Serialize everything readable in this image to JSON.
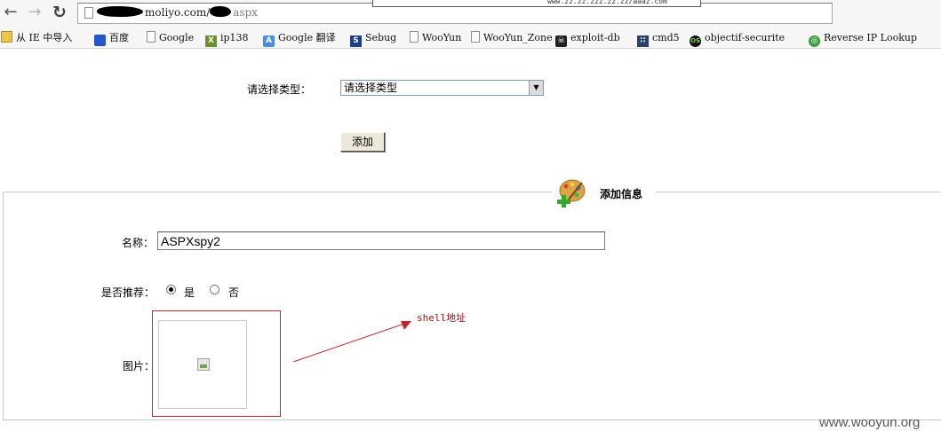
{
  "browser": {
    "nav": {
      "back_glyph": "←",
      "forward_glyph": "→",
      "reload_glyph": "↻"
    },
    "url": {
      "domain": "moliyo.com/",
      "path": "aspx"
    },
    "autocomplete_snippet": "www.zz.zz.zzz.zz.zz/aaaz.com",
    "bookmarks": [
      {
        "label": "从 IE 中导入",
        "icon": "folder-icon"
      },
      {
        "label": "百度",
        "icon": "baidu-icon"
      },
      {
        "label": "Google",
        "icon": "page-icon"
      },
      {
        "label": "ip138",
        "icon": "ip138-icon"
      },
      {
        "label": "Google 翻译",
        "icon": "google-translate-icon"
      },
      {
        "label": "Sebug",
        "icon": "sebug-icon"
      },
      {
        "label": "WooYun",
        "icon": "page-icon"
      },
      {
        "label": "WooYun_Zone",
        "icon": "page-icon"
      },
      {
        "label": "exploit-db",
        "icon": "exploit-db-icon"
      },
      {
        "label": "cmd5",
        "icon": "cmd5-icon"
      },
      {
        "label": "objectif-securite",
        "icon": "objectif-securite-icon"
      },
      {
        "label": "Reverse IP Lookup",
        "icon": "globe-icon"
      }
    ]
  },
  "form": {
    "type_label": "请选择类型：",
    "type_select_value": "请选择类型",
    "add_button": "添加",
    "section_title": "添加信息",
    "name_label": "名称：",
    "name_value": "ASPXspy2",
    "recommend_label": "是否推荐：",
    "recommend_yes": "是",
    "recommend_no": "否",
    "recommend_selected": "yes",
    "image_label": "图片："
  },
  "annotation": {
    "text": "shell地址",
    "color": "#a50f12"
  },
  "watermark": "www.wooyun.org",
  "colors": {
    "annotation_red": "#c0282b",
    "fieldset_border": "#c8c8c8"
  }
}
